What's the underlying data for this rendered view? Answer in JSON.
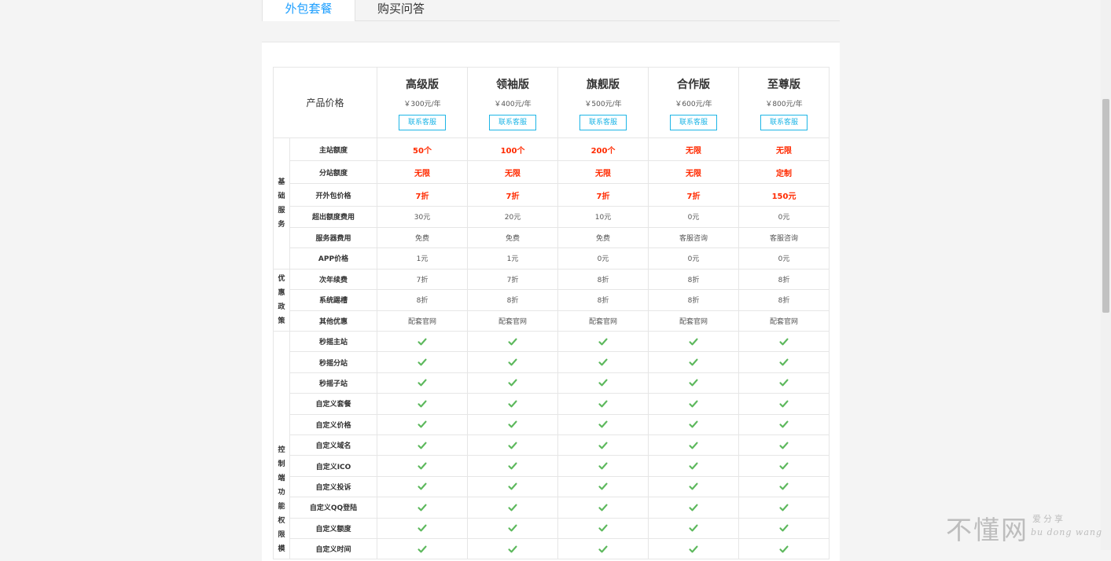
{
  "tabs": [
    {
      "label": "外包套餐",
      "active": true
    },
    {
      "label": "购买问答",
      "active": false
    }
  ],
  "table": {
    "price_label": "产品价格",
    "contact_label": "联系客服",
    "plans": [
      {
        "name": "高级版",
        "price": "￥300元/年"
      },
      {
        "name": "领袖版",
        "price": "￥400元/年"
      },
      {
        "name": "旗舰版",
        "price": "￥500元/年"
      },
      {
        "name": "合作版",
        "price": "￥600元/年"
      },
      {
        "name": "至尊版",
        "price": "￥800元/年"
      }
    ],
    "categories": [
      {
        "name": "基础服务",
        "rows": [
          {
            "feature": "主站额度",
            "style": "red",
            "values": [
              "50个",
              "100个",
              "200个",
              "无限",
              "无限"
            ]
          },
          {
            "feature": "分站额度",
            "style": "red",
            "values": [
              "无限",
              "无限",
              "无限",
              "无限",
              "定制"
            ]
          },
          {
            "feature": "开外包价格",
            "style": "red",
            "values": [
              "7折",
              "7折",
              "7折",
              "7折",
              "150元"
            ]
          },
          {
            "feature": "超出额度费用",
            "style": "plain",
            "values": [
              "30元",
              "20元",
              "10元",
              "0元",
              "0元"
            ]
          },
          {
            "feature": "服务器费用",
            "style": "plain",
            "values": [
              "免费",
              "免费",
              "免费",
              "客服咨询",
              "客服咨询"
            ]
          },
          {
            "feature": "APP价格",
            "style": "plain",
            "values": [
              "1元",
              "1元",
              "0元",
              "0元",
              "0元"
            ]
          }
        ]
      },
      {
        "name": "优惠政策",
        "rows": [
          {
            "feature": "次年续费",
            "style": "plain",
            "values": [
              "7折",
              "7折",
              "8折",
              "8折",
              "8折"
            ]
          },
          {
            "feature": "系统踢槽",
            "style": "plain",
            "values": [
              "8折",
              "8折",
              "8折",
              "8折",
              "8折"
            ]
          },
          {
            "feature": "其他优惠",
            "style": "plain",
            "values": [
              "配套官网",
              "配套官网",
              "配套官网",
              "配套官网",
              "配套官网"
            ]
          }
        ]
      },
      {
        "name": "控制端功能权限模",
        "rows": [
          {
            "feature": "秒摇主站",
            "style": "check",
            "values": [
              "check",
              "check",
              "check",
              "check",
              "check"
            ]
          },
          {
            "feature": "秒摇分站",
            "style": "check",
            "values": [
              "check",
              "check",
              "check",
              "check",
              "check"
            ]
          },
          {
            "feature": "秒摇子站",
            "style": "check",
            "values": [
              "check",
              "check",
              "check",
              "check",
              "check"
            ]
          },
          {
            "feature": "自定义套餐",
            "style": "check",
            "values": [
              "check",
              "check",
              "check",
              "check",
              "check"
            ]
          },
          {
            "feature": "自定义价格",
            "style": "check",
            "values": [
              "check",
              "check",
              "check",
              "check",
              "check"
            ]
          },
          {
            "feature": "自定义域名",
            "style": "check",
            "values": [
              "check",
              "check",
              "check",
              "check",
              "check"
            ]
          },
          {
            "feature": "自定义ICO",
            "style": "check",
            "values": [
              "check",
              "check",
              "check",
              "check",
              "check"
            ]
          },
          {
            "feature": "自定义投诉",
            "style": "check",
            "values": [
              "check",
              "check",
              "check",
              "check",
              "check"
            ]
          },
          {
            "feature": "自定义QQ登陆",
            "style": "check",
            "values": [
              "check",
              "check",
              "check",
              "check",
              "check"
            ]
          },
          {
            "feature": "自定义额度",
            "style": "check",
            "values": [
              "check",
              "check",
              "check",
              "check",
              "check"
            ]
          },
          {
            "feature": "自定义时间",
            "style": "check",
            "values": [
              "check",
              "check",
              "check",
              "check",
              "check"
            ]
          }
        ]
      }
    ]
  },
  "colors": {
    "accent": "#1e9fff",
    "button_border": "#1eb5e6",
    "highlight_red": "#ff2a00",
    "check_green": "#5cb85c"
  },
  "icons": {
    "check": "check-icon"
  },
  "watermark": {
    "main": "不懂网",
    "line1": "爱分享",
    "line2": "bu dong wang"
  }
}
